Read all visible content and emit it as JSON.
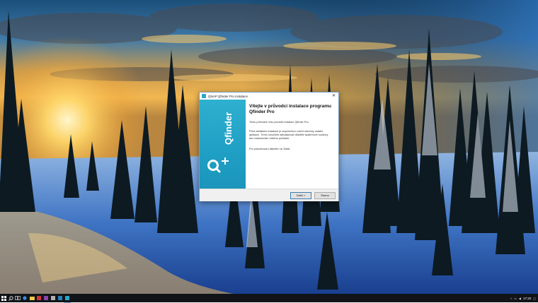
{
  "installer": {
    "window_title": "QNAP Qfinder Pro instalace",
    "close_glyph": "✕",
    "banner_brand": "Qfinder",
    "heading": "Vítejte v průvodci instalace programu Qfinder Pro",
    "para1": "Tento průvodce Vás provede instalací Qfinder Pro.",
    "para2": "Před začátkem instalace je doporučeno zavřít všechny ostatní aplikace. Tímto umožníte aktualizovat důležité systémové soubory bez restartování Vašeho počítače.",
    "para3": "Pro pokračování klikněte na 'Další'.",
    "next_label": "Další >",
    "cancel_label": "Storno"
  },
  "taskbar": {
    "icons": [
      "windows-start-icon",
      "search-icon",
      "task-view-icon",
      "edge-icon",
      "file-explorer-icon",
      "store-icon",
      "mail-icon",
      "app-icon",
      "app-icon-2",
      "installer-taskbar-icon"
    ],
    "clock": "17:20",
    "notification_icon": "action-center-icon"
  },
  "colors": {
    "banner": "#2aa6c8",
    "taskbar": "#101318",
    "accent_border": "#3c7fb1"
  }
}
